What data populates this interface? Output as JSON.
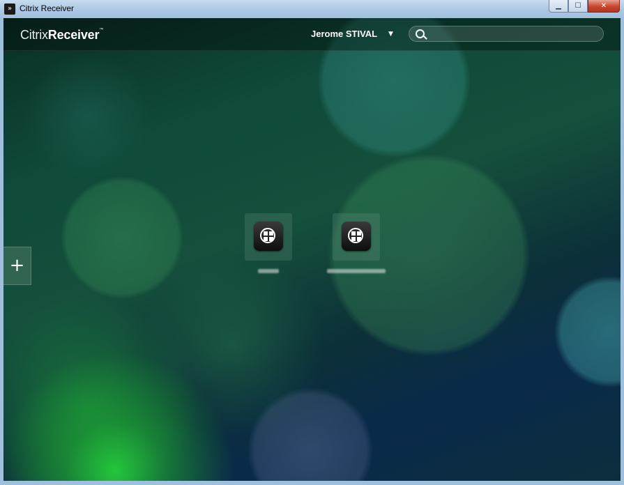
{
  "window": {
    "title": "Citrix Receiver",
    "app_icon": "citrix-receiver-icon",
    "controls": {
      "minimize": "▁",
      "maximize": "☐",
      "close": "✕"
    }
  },
  "header": {
    "logo_primary": "Citrix",
    "logo_secondary": "Receiver",
    "logo_tm": "™",
    "user_name": "Jerome STIVAL",
    "user_caret": "▼",
    "search_placeholder": ""
  },
  "sidebar": {
    "add_label": "+"
  },
  "apps": [
    {
      "icon": "windows-desktop-icon",
      "label": ""
    },
    {
      "icon": "windows-desktop-icon",
      "label": ""
    }
  ]
}
